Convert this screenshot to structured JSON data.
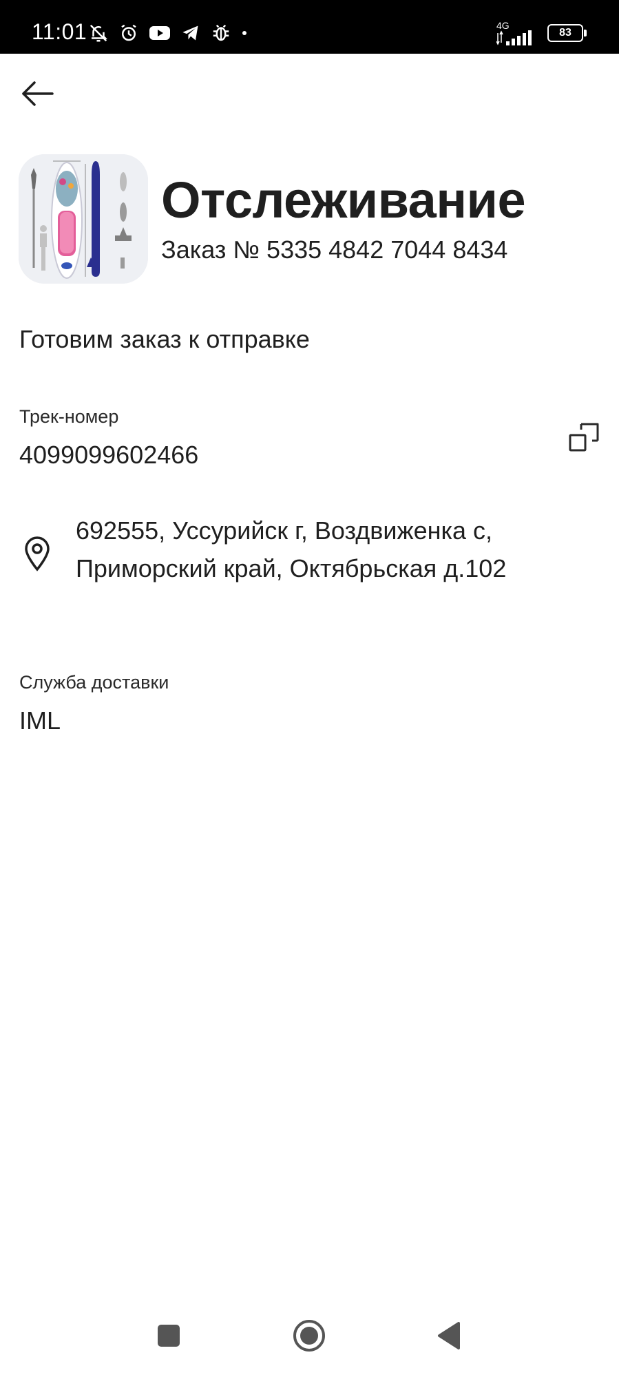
{
  "status_bar": {
    "time": "11:01",
    "network": "4G",
    "battery": "83",
    "icons": [
      "bell-off-icon",
      "alarm-icon",
      "youtube-icon",
      "telegram-icon",
      "bug-icon",
      "dot-icon"
    ]
  },
  "nav": {
    "back_icon": "arrow-left-icon"
  },
  "header": {
    "title": "Отслеживание",
    "order_number": "Заказ № 5335 4842 7044 8434"
  },
  "shipment": {
    "status": "Готовим заказ к отправке",
    "track_label": "Трек-номер",
    "track_number": "4099099602466",
    "address_line1": "692555, Уссурийск г, Воздвиженка с,",
    "address_line2": "Приморский край, Октябрьская д.102",
    "delivery_label": "Служба доставки",
    "delivery_service": "IML"
  },
  "system_nav": {
    "recents": "square-icon",
    "home": "circle-icon",
    "back": "triangle-back-icon"
  }
}
